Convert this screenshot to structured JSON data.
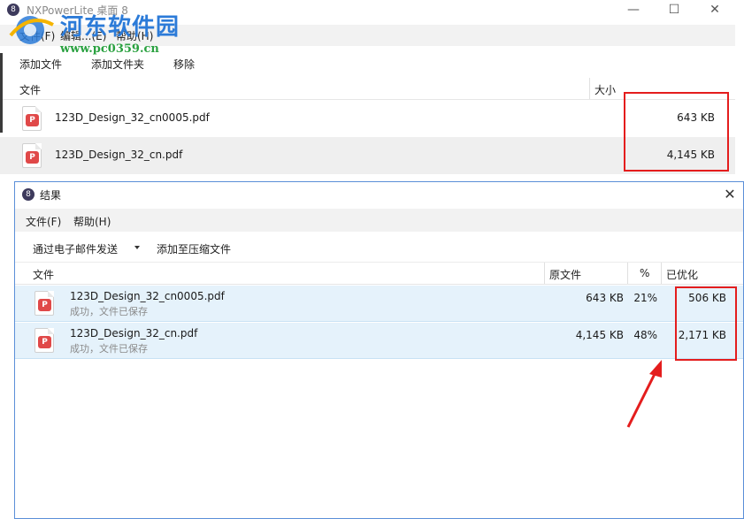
{
  "main_window": {
    "title": "NXPowerLite 桌面 8",
    "controls": {
      "minimize": "—",
      "maximize": "☐",
      "close": "✕"
    },
    "menu": [
      "文件(F)",
      "编辑...(E)",
      "帮助(H)"
    ],
    "toolbar": [
      "添加文件",
      "添加文件夹",
      "移除"
    ],
    "columns": {
      "file": "文件",
      "size": "大小"
    },
    "files": [
      {
        "name": "123D_Design_32_cn0005.pdf",
        "size": "643 KB"
      },
      {
        "name": "123D_Design_32_cn.pdf",
        "size": "4,145 KB"
      }
    ]
  },
  "watermark": {
    "title": "河东软件园",
    "url": "www.pc0359.cn"
  },
  "result_dialog": {
    "title": "结果",
    "close": "✕",
    "menu": [
      "文件(F)",
      "帮助(H)"
    ],
    "toolbar": {
      "email": "通过电子邮件发送",
      "zip": "添加至压缩文件"
    },
    "columns": {
      "file": "文件",
      "original": "原文件",
      "percent": "%",
      "optimized": "已优化"
    },
    "results": [
      {
        "name": "123D_Design_32_cn0005.pdf",
        "status": "成功，文件已保存",
        "original": "643 KB",
        "percent": "21%",
        "optimized": "506 KB"
      },
      {
        "name": "123D_Design_32_cn.pdf",
        "status": "成功，文件已保存",
        "original": "4,145 KB",
        "percent": "48%",
        "optimized": "2,171 KB"
      }
    ]
  },
  "icons": {
    "app": "nxpowerlite-app-icon",
    "pdf": "pdf-file-icon",
    "pdf_glyph": "P",
    "app_glyph": "8"
  },
  "colors": {
    "highlight_box": "#e41d1d",
    "selected_row": "#e5f2fb",
    "watermark_blue": "#2c7bd8",
    "watermark_green": "#2aa140"
  }
}
